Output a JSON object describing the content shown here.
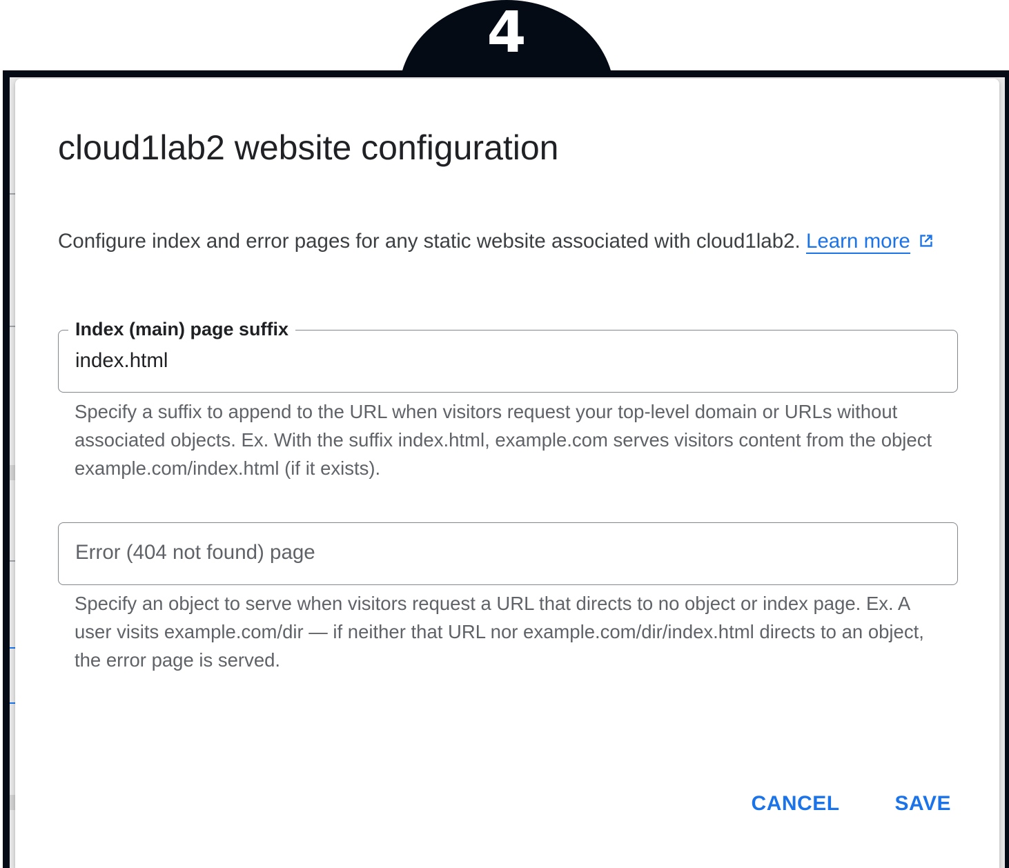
{
  "step_badge": {
    "number": "4"
  },
  "dialog": {
    "title": "cloud1lab2 website configuration",
    "description": "Configure index and error pages for any static website associated with cloud1lab2. ",
    "learn_more_label": "Learn more",
    "learn_more_icon": "external-link-icon",
    "index_field": {
      "label": "Index (main) page suffix",
      "value": "index.html",
      "hint": "Specify a suffix to append to the URL when visitors request your top-level domain or URLs without associated objects. Ex. With the suffix index.html, example.com serves visitors content from the object example.com/index.html (if it exists)."
    },
    "error_field": {
      "value": "",
      "placeholder": "Error (404 not found) page",
      "hint": "Specify an object to serve when visitors request a URL that directs to no object or index page. Ex. A user visits example.com/dir — if neither that URL nor example.com/dir/index.html directs to an object, the error page is served."
    },
    "actions": {
      "cancel_label": "CANCEL",
      "save_label": "SAVE"
    }
  },
  "colors": {
    "accent": "#1a73e8",
    "frame": "#050b14",
    "title_text": "#202124",
    "hint_text": "#5f6368",
    "field_border": "#80868b"
  }
}
